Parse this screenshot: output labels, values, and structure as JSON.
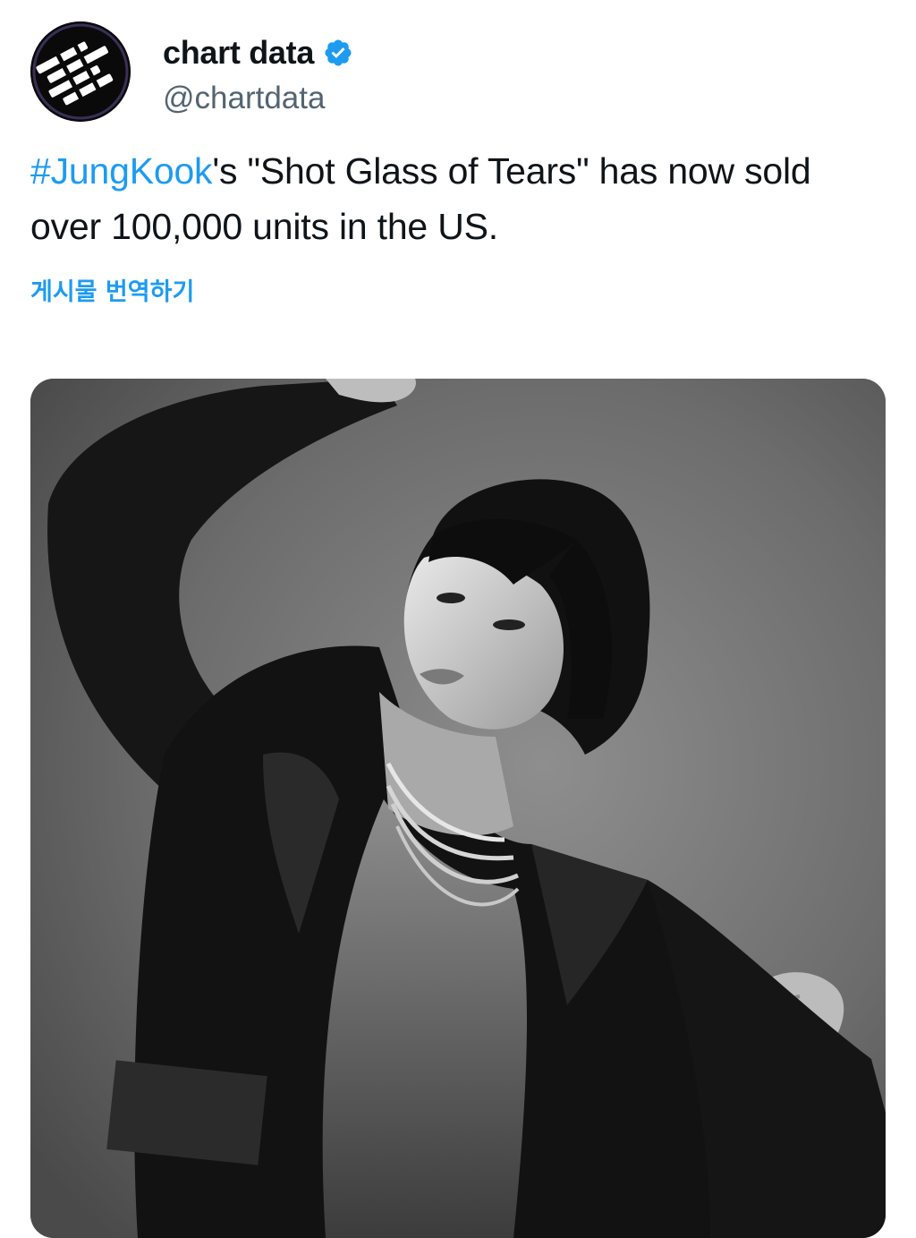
{
  "author": {
    "display_name": "chart data",
    "handle": "@chartdata",
    "verified": true,
    "verified_color": "#1d9bf0"
  },
  "tweet": {
    "hashtag": "#JungKook",
    "text_after_hashtag": "'s \"Shot Glass of Tears\" has now sold over 100,000 units in the US.",
    "translate_label": "게시물 번역하기"
  },
  "media": {
    "type": "photo",
    "style": "black-and-white portrait"
  },
  "colors": {
    "link": "#1d9bf0",
    "text": "#0f1419",
    "secondary_text": "#536471"
  }
}
